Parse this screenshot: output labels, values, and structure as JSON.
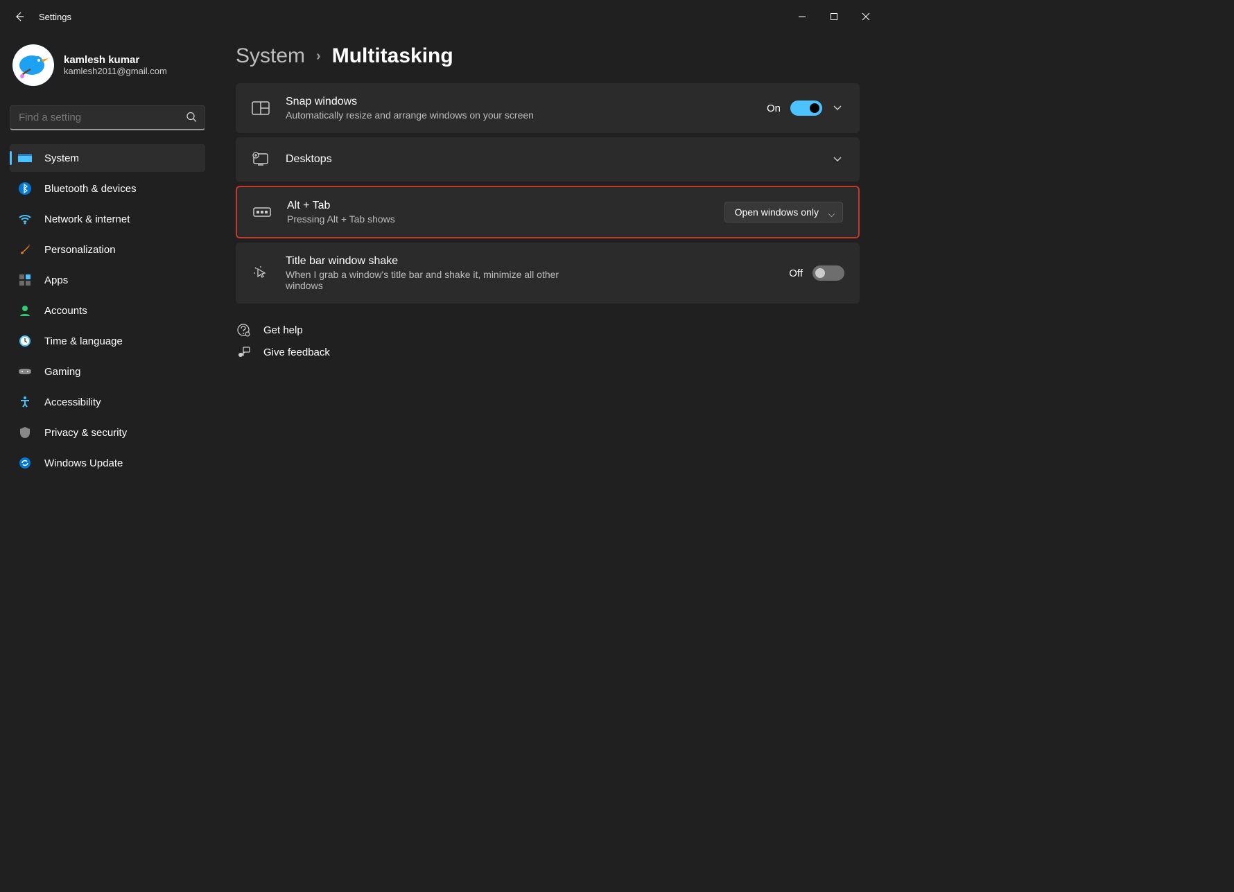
{
  "app_title": "Settings",
  "user": {
    "name": "kamlesh kumar",
    "email": "kamlesh2011@gmail.com"
  },
  "search": {
    "placeholder": "Find a setting"
  },
  "sidebar": {
    "active_index": 0,
    "items": [
      {
        "label": "System"
      },
      {
        "label": "Bluetooth & devices"
      },
      {
        "label": "Network & internet"
      },
      {
        "label": "Personalization"
      },
      {
        "label": "Apps"
      },
      {
        "label": "Accounts"
      },
      {
        "label": "Time & language"
      },
      {
        "label": "Gaming"
      },
      {
        "label": "Accessibility"
      },
      {
        "label": "Privacy & security"
      },
      {
        "label": "Windows Update"
      }
    ]
  },
  "breadcrumb": {
    "parent": "System",
    "current": "Multitasking"
  },
  "cards": {
    "snap": {
      "title": "Snap windows",
      "sub": "Automatically resize and arrange windows on your screen",
      "state": "On"
    },
    "desktops": {
      "title": "Desktops"
    },
    "alttab": {
      "title": "Alt + Tab",
      "sub": "Pressing Alt + Tab shows",
      "value": "Open windows only"
    },
    "shake": {
      "title": "Title bar window shake",
      "sub": "When I grab a window's title bar and shake it, minimize all other windows",
      "state": "Off"
    }
  },
  "footer": {
    "help": "Get help",
    "feedback": "Give feedback"
  }
}
